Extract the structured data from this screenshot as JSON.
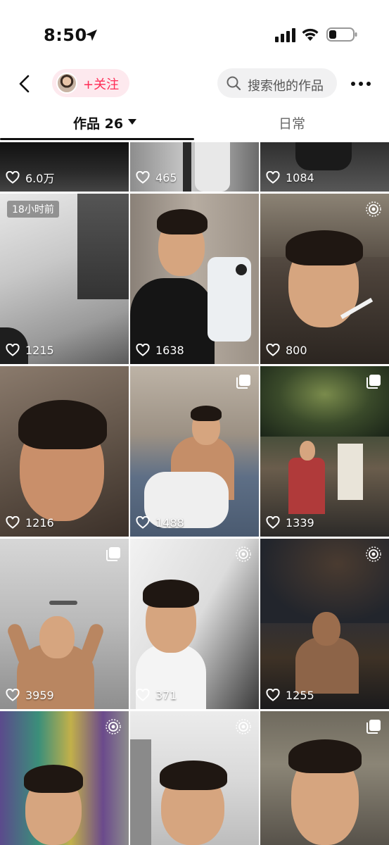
{
  "status_bar": {
    "time": "8:50"
  },
  "header": {
    "follow_label": "+关注",
    "search_placeholder": "搜索他的作品"
  },
  "tabs": {
    "works_label": "作品 26",
    "daily_label": "日常"
  },
  "colors": {
    "accent": "#fe2c55",
    "follow_bg": "#fde9ee",
    "search_bg": "#f1f1f2"
  },
  "grid": {
    "tiles": [
      {
        "likes": "6.0万"
      },
      {
        "likes": "465"
      },
      {
        "likes": "1084"
      },
      {
        "likes": "1215",
        "badge_text": "18小时前"
      },
      {
        "likes": "1638"
      },
      {
        "likes": "800",
        "badge_icon": "live-photo-icon"
      },
      {
        "likes": "1216"
      },
      {
        "likes": "1488",
        "badge_icon": "multi-image-icon"
      },
      {
        "likes": "1339",
        "badge_icon": "multi-image-icon"
      },
      {
        "likes": "3959",
        "badge_icon": "multi-image-icon"
      },
      {
        "likes": "371",
        "badge_icon": "live-photo-icon"
      },
      {
        "likes": "1255",
        "badge_icon": "live-photo-icon"
      },
      {
        "badge_icon": "live-photo-icon"
      },
      {
        "badge_icon": "live-photo-icon"
      },
      {
        "badge_icon": "multi-image-icon"
      }
    ]
  }
}
